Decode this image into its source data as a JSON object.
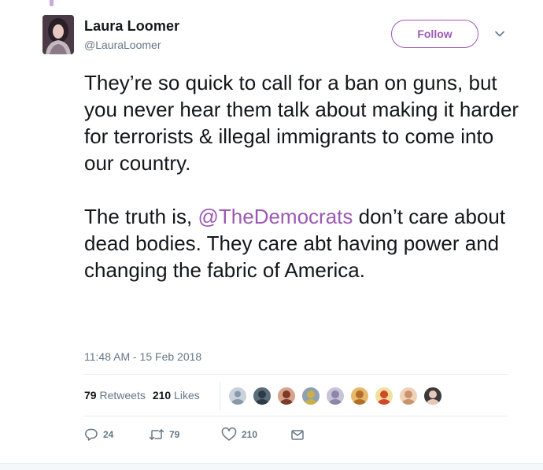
{
  "tweet": {
    "author": {
      "display_name": "Laura Loomer",
      "username": "@LauraLoomer",
      "avatar": "profile-photo"
    },
    "follow_label": "Follow",
    "caret_icon": "chevron-down-icon",
    "paragraph_1": "They’re so quick to call for a ban on guns, but you never hear them talk about making it harder for terrorists & illegal immigrants to come into our country.",
    "paragraph_2": {
      "before": "The truth is, ",
      "mention": "@TheDemocrats",
      "after": " don’t care about dead bodies. They care abt having power and changing the fabric of America."
    },
    "timestamp": "11:48 AM - 15 Feb 2018",
    "stats": {
      "retweets_count": "79",
      "retweets_label": "Retweets",
      "likes_count": "210",
      "likes_label": "Likes"
    },
    "liker_avatars": [
      {
        "name": "default-avatar",
        "bg": "#c8d2dc",
        "fg": "#8899a6"
      },
      {
        "name": "photo-avatar",
        "bg": "#5a6d7a",
        "fg": "#2f3b44"
      },
      {
        "name": "photo-avatar",
        "bg": "#d9a38a",
        "fg": "#7a3b2a"
      },
      {
        "name": "photo-avatar",
        "bg": "#8fa0b4",
        "fg": "#c9b04a"
      },
      {
        "name": "photo-avatar",
        "bg": "#c8c4d6",
        "fg": "#8d86a8"
      },
      {
        "name": "photo-avatar",
        "bg": "#e8b86a",
        "fg": "#b06e2a"
      },
      {
        "name": "photo-avatar",
        "bg": "#f2e0a0",
        "fg": "#d04a2a"
      },
      {
        "name": "photo-avatar",
        "bg": "#f0d2b8",
        "fg": "#c89470"
      },
      {
        "name": "photo-avatar",
        "bg": "#3a3a3a",
        "fg": "#e8c8b8"
      }
    ],
    "actions": {
      "reply_icon": "reply-icon",
      "reply_count": "24",
      "retweet_icon": "retweet-icon",
      "retweet_count": "79",
      "like_icon": "heart-icon",
      "like_count": "210",
      "dm_icon": "envelope-icon"
    },
    "colors": {
      "accent": "#9b59b6",
      "text": "#14171a",
      "secondary": "#657786",
      "divider": "#e6ecf0"
    }
  }
}
